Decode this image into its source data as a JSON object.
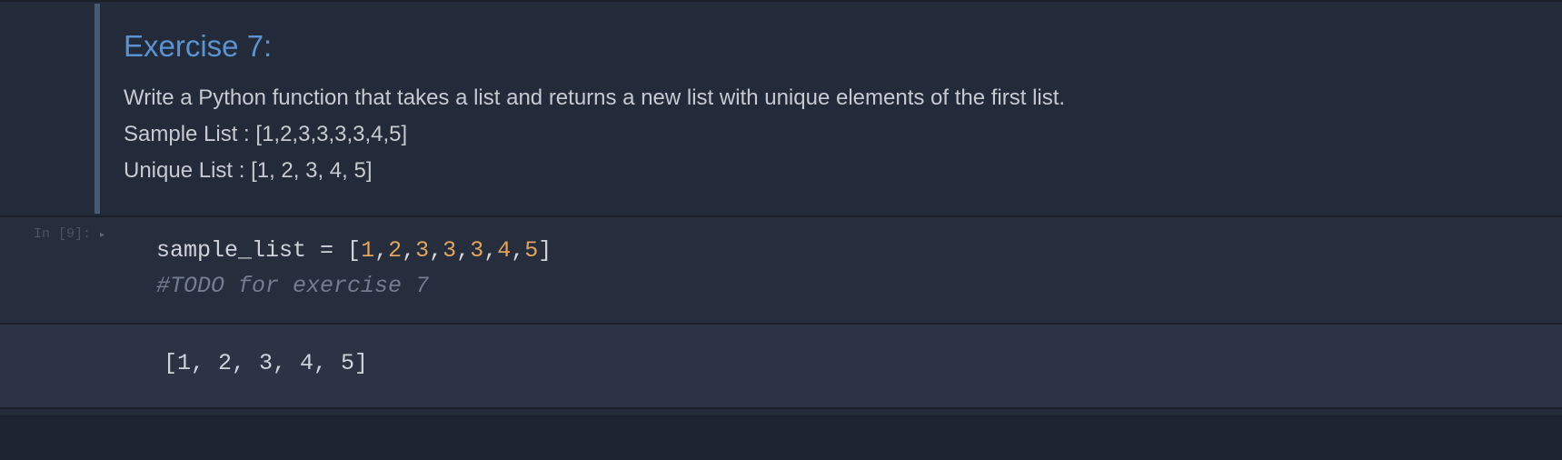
{
  "markdown": {
    "heading": "Exercise 7:",
    "lines": [
      "Write a Python function that takes a list and returns a new list with unique elements of the first list.",
      "Sample List : [1,2,3,3,3,3,4,5]",
      "Unique List : [1, 2, 3, 4, 5]"
    ]
  },
  "code": {
    "prompt": "In [9]:",
    "line1": {
      "var": "sample_list",
      "op": " = ",
      "open": "[",
      "n0": "1",
      "c0": ",",
      "n1": "2",
      "c1": ",",
      "n2": "3",
      "c2": ",",
      "n3": "3",
      "c3": ",",
      "n4": "3",
      "c4": ",",
      "n5": "4",
      "c5": ",",
      "n6": "5",
      "close": "]"
    },
    "line2_comment": "#TODO for exercise 7"
  },
  "output": {
    "text": "[1, 2, 3, 4, 5]"
  }
}
